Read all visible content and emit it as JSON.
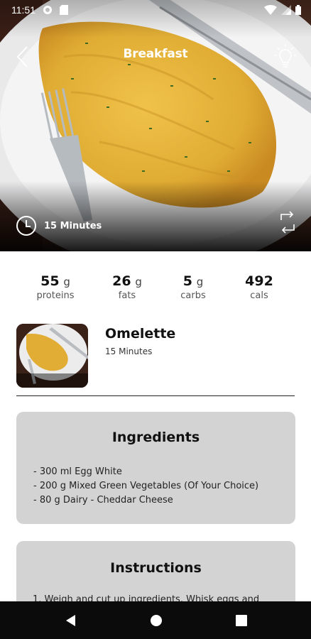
{
  "status_bar": {
    "time": "11:51"
  },
  "header": {
    "title": "Breakfast"
  },
  "hero": {
    "time_label": "15 Minutes"
  },
  "macros": [
    {
      "value": "55",
      "unit": "g",
      "label": "proteins"
    },
    {
      "value": "26",
      "unit": "g",
      "label": "fats"
    },
    {
      "value": "5",
      "unit": "g",
      "label": "carbs"
    },
    {
      "value": "492",
      "unit": "",
      "label": "cals"
    }
  ],
  "recipe": {
    "name": "Omelette",
    "time": "15 Minutes"
  },
  "ingredients": {
    "title": "Ingredients",
    "items": [
      "- 300 ml Egg White",
      "- 200 g Mixed Green Vegetables (Of Your Choice)",
      "- 80 g Dairy - Cheddar Cheese"
    ]
  },
  "instructions": {
    "title": "Instructions",
    "text": "1. Weigh and cut up ingredients. Whisk eggs and"
  },
  "colors": {
    "card_bg": "#d3d3d3",
    "omelette": "#e3b53a",
    "nav_bg": "#0b0b0b"
  },
  "icons": [
    "settings-icon",
    "sd-card-icon",
    "wifi-icon",
    "signal-icon",
    "battery-icon",
    "back-icon",
    "lightbulb-icon",
    "clock-icon",
    "swap-icon",
    "nav-back-icon",
    "nav-home-icon",
    "nav-recents-icon"
  ]
}
